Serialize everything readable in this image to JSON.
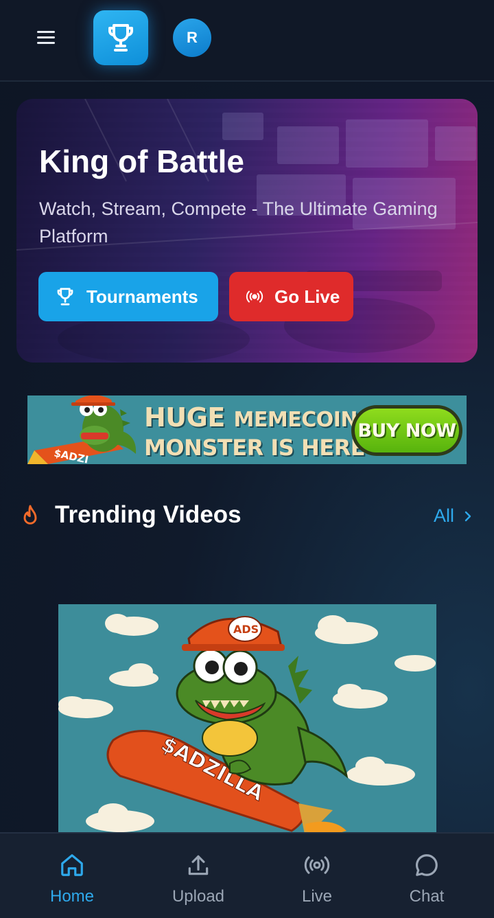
{
  "header": {
    "avatar_initial": "R"
  },
  "hero": {
    "title": "King of Battle",
    "subtitle": "Watch, Stream, Compete - The Ultimate Gaming Platform",
    "buttons": {
      "tournaments": "Tournaments",
      "go_live": "Go Live"
    }
  },
  "ad_banner": {
    "line1_big": "HUGE",
    "line1_small": "MEMECOIN",
    "line2": "MONSTER IS HERE",
    "cta": "BUY NOW",
    "mascot_text": "$ADZI"
  },
  "trending": {
    "title": "Trending Videos",
    "see_all": "All",
    "video": {
      "cap_text": "ADS",
      "rocket_text": "$ADZILLA"
    }
  },
  "bottom_nav": {
    "items": [
      {
        "label": "Home",
        "icon": "home-icon",
        "active": true
      },
      {
        "label": "Upload",
        "icon": "upload-icon",
        "active": false
      },
      {
        "label": "Live",
        "icon": "broadcast-icon",
        "active": false
      },
      {
        "label": "Chat",
        "icon": "chat-bubble-icon",
        "active": false
      }
    ]
  },
  "colors": {
    "accent": "#2ea9ec",
    "live_red": "#df2b2b",
    "background": "#101827",
    "fire": "#f26a2a"
  }
}
